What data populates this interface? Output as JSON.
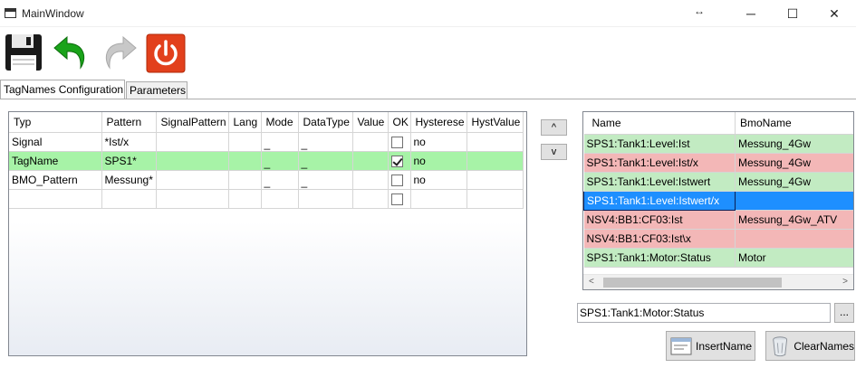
{
  "window": {
    "title": "MainWindow",
    "resize_glyph": "↔",
    "minimize_glyph": "─",
    "maximize_glyph": "☐",
    "close_glyph": "✕"
  },
  "toolbar": {
    "save_icon": "floppy-disk-icon",
    "undo_icon": "undo-arrow-icon",
    "redo_icon": "redo-arrow-icon",
    "power_icon": "power-icon",
    "colors": {
      "undo": "#1aa31a",
      "redo": "#c8c8c8",
      "power": "#e2401c"
    }
  },
  "tabs": [
    {
      "label": "TagNames Configuration",
      "active": true
    },
    {
      "label": "Parameters",
      "active": false
    }
  ],
  "config_grid": {
    "columns": [
      "Typ",
      "Pattern",
      "SignalPattern",
      "Lang",
      "Mode",
      "DataType",
      "Value",
      "OK",
      "Hysterese",
      "HystValue"
    ],
    "rows": [
      {
        "typ": "Signal",
        "pattern": "*Ist/x",
        "signal_pattern": "",
        "lang": "",
        "mode": "_",
        "data_type": "_",
        "value": "",
        "ok": false,
        "hysterese": "no",
        "hyst_value": ""
      },
      {
        "typ": "TagName",
        "pattern": "SPS1*",
        "signal_pattern": "",
        "lang": "",
        "mode": "_",
        "data_type": "_",
        "value": "",
        "ok": true,
        "hysterese": "no",
        "hyst_value": ""
      },
      {
        "typ": "BMO_Pattern",
        "pattern": "Messung*",
        "signal_pattern": "",
        "lang": "",
        "mode": "_",
        "data_type": "_",
        "value": "",
        "ok": false,
        "hysterese": "no",
        "hyst_value": ""
      },
      {
        "typ": "",
        "pattern": "",
        "signal_pattern": "",
        "lang": "",
        "mode": "",
        "data_type": "",
        "value": "",
        "ok": false,
        "hysterese": "",
        "hyst_value": ""
      }
    ],
    "selected_row_color": "#a7f3a7"
  },
  "move_buttons": {
    "up_label": "^",
    "down_label": "v"
  },
  "names_grid": {
    "columns": [
      "Name",
      "BmoName"
    ],
    "rows": [
      {
        "name": "SPS1:Tank1:Level:Ist",
        "bmo_name": "Messung_4Gw",
        "status": "green"
      },
      {
        "name": "SPS1:Tank1:Level:Ist/x",
        "bmo_name": "Messung_4Gw",
        "status": "red"
      },
      {
        "name": "SPS1:Tank1:Level:Istwert",
        "bmo_name": "Messung_4Gw",
        "status": "green"
      },
      {
        "name": "SPS1:Tank1:Level:Istwert/x",
        "bmo_name": "",
        "status": "blue"
      },
      {
        "name": "NSV4:BB1:CF03:Ist",
        "bmo_name": "Messung_4Gw_ATV",
        "status": "red"
      },
      {
        "name": "NSV4:BB1:CF03:Ist\\x",
        "bmo_name": "",
        "status": "red"
      },
      {
        "name": "SPS1:Tank1:Motor:Status",
        "bmo_name": "Motor",
        "status": "green"
      }
    ],
    "status_colors": {
      "green": "#c2ebc2",
      "red": "#f3b7b7",
      "blue": "#1e8fff"
    },
    "scroll_left": "<",
    "scroll_right": ">"
  },
  "name_input": {
    "value": "SPS1:Tank1:Motor:Status",
    "browse_label": "..."
  },
  "actions": {
    "insert_label": "InsertName",
    "insert_icon": "insert-name-icon",
    "clear_label": "ClearNames",
    "clear_icon": "trash-can-icon"
  }
}
